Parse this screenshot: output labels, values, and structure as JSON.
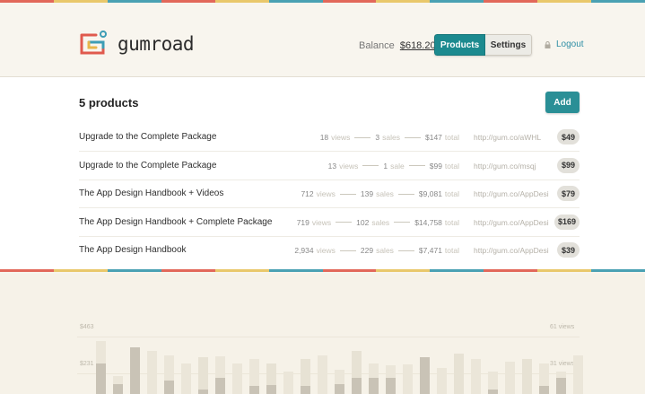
{
  "colors": {
    "stripe": [
      "#e2685a",
      "#e9c86b",
      "#4aa1b3",
      "#e2685a",
      "#e9c86b",
      "#4aa1b3",
      "#e2685a",
      "#e9c86b",
      "#4aa1b3",
      "#e2685a",
      "#e9c86b",
      "#4aa1b3"
    ],
    "accent": "#1c8a8f"
  },
  "header": {
    "logo_text": "gumroad",
    "balance_label": "Balance",
    "balance_amount": "$618.20",
    "nav": {
      "products": "Products",
      "settings": "Settings"
    },
    "logout": "Logout"
  },
  "products": {
    "title": "5 products",
    "add_label": "Add",
    "rows": [
      {
        "name": "Upgrade to the Complete Package",
        "views": "18",
        "views_label": "views",
        "sales": "3",
        "sales_label": "sales",
        "total": "$147",
        "total_label": "total",
        "url": "http://gum.co/aWHL",
        "price": "$49"
      },
      {
        "name": "Upgrade to the Complete Package",
        "views": "13",
        "views_label": "views",
        "sales": "1",
        "sales_label": "sale",
        "total": "$99",
        "total_label": "total",
        "url": "http://gum.co/msqj",
        "price": "$99"
      },
      {
        "name": "The App Design Handbook + Videos",
        "views": "712",
        "views_label": "views",
        "sales": "139",
        "sales_label": "sales",
        "total": "$9,081",
        "total_label": "total",
        "url": "http://gum.co/AppDesig",
        "price": "$79"
      },
      {
        "name": "The App Design Handbook + Complete Package",
        "views": "719",
        "views_label": "views",
        "sales": "102",
        "sales_label": "sales",
        "total": "$14,758",
        "total_label": "total",
        "url": "http://gum.co/AppDesig",
        "price": "$169"
      },
      {
        "name": "The App Design Handbook",
        "views": "2,934",
        "views_label": "views",
        "sales": "229",
        "sales_label": "sales",
        "total": "$7,471",
        "total_label": "total",
        "url": "http://gum.co/AppDesig",
        "price": "$39"
      }
    ]
  },
  "chart_data": {
    "type": "bar",
    "left_ticks": [
      "$463",
      "$231"
    ],
    "right_ticks": [
      "61 views",
      "31 views"
    ],
    "ylim": [
      0,
      463
    ],
    "series": [
      {
        "values": [
          260,
          90,
          0,
          210,
          190,
          150,
          0,
          185,
          150,
          170,
          0,
          110,
          0,
          190,
          120,
          0,
          150,
          140,
          145,
          140,
          130,
          0,
          170,
          110,
          160,
          0,
          150,
          110,
          190
        ],
        "color": "#ebe6d9"
      },
      {
        "values": [
          0,
          0,
          90,
          0,
          0,
          0,
          180,
          0,
          0,
          0,
          150,
          0,
          170,
          0,
          0,
          210,
          0,
          0,
          0,
          0,
          0,
          200,
          0,
          0,
          0,
          170,
          0,
          0,
          0
        ],
        "color": "#e7e2d4"
      },
      {
        "values": [
          150,
          50,
          230,
          0,
          65,
          0,
          20,
          80,
          0,
          40,
          45,
          0,
          40,
          0,
          50,
          80,
          80,
          80,
          0,
          180,
          0,
          0,
          0,
          20,
          0,
          0,
          40,
          80,
          0
        ],
        "color": "#c9c3b6"
      }
    ]
  }
}
